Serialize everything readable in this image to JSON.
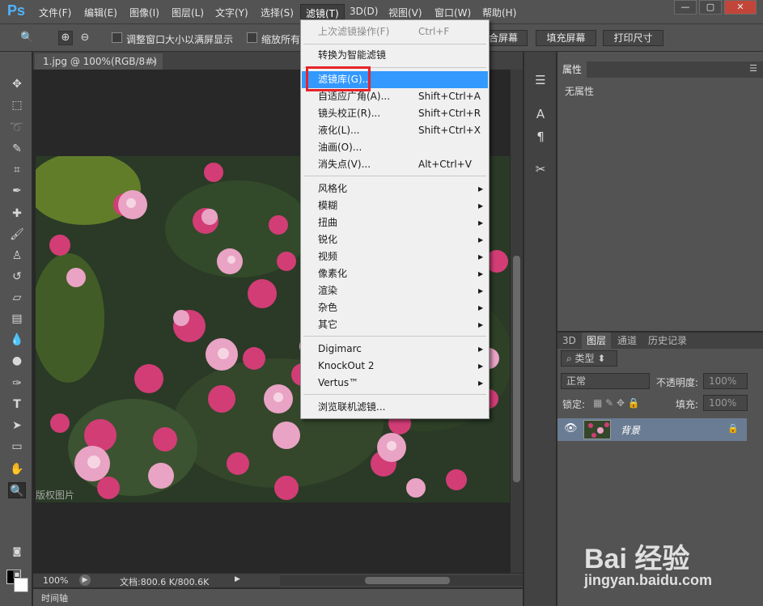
{
  "app": {
    "logo": "Ps"
  },
  "menubar": {
    "items": [
      "文件(F)",
      "编辑(E)",
      "图像(I)",
      "图层(L)",
      "文字(Y)",
      "选择(S)",
      "滤镜(T)",
      "3D(D)",
      "视图(V)",
      "窗口(W)",
      "帮助(H)"
    ],
    "active_index": 6
  },
  "window_controls": {
    "minimize": "—",
    "restore": "▢",
    "close": "✕"
  },
  "options_bar": {
    "checkbox1_label": "调整窗口大小以满屏显示",
    "checkbox2_label": "缩放所有",
    "btn_fit_screen": "合屏幕",
    "btn_fill_screen": "填充屏幕",
    "btn_print_size": "打印尺寸"
  },
  "document": {
    "tab_title": "1.jpg @ 100%(RGB/8#)",
    "tab_close": "×",
    "photo_watermark": "版权图片",
    "zoom": "100%",
    "doc_size": "文档:800.6 K/800.6K",
    "timeline_label": "时间轴"
  },
  "filter_menu": {
    "items": [
      {
        "label": "上次滤镜操作(F)",
        "shortcut": "Ctrl+F",
        "state": "disabled"
      },
      {
        "label": "转换为智能滤镜",
        "shortcut": "",
        "state": "normal"
      },
      {
        "label": "滤镜库(G)...",
        "shortcut": "",
        "state": "highlighted"
      },
      {
        "label": "自适应广角(A)...",
        "shortcut": "Shift+Ctrl+A",
        "state": "normal"
      },
      {
        "label": "镜头校正(R)...",
        "shortcut": "Shift+Ctrl+R",
        "state": "normal"
      },
      {
        "label": "液化(L)...",
        "shortcut": "Shift+Ctrl+X",
        "state": "normal"
      },
      {
        "label": "油画(O)...",
        "shortcut": "",
        "state": "normal"
      },
      {
        "label": "消失点(V)...",
        "shortcut": "Alt+Ctrl+V",
        "state": "normal"
      },
      {
        "label": "风格化",
        "submenu": true
      },
      {
        "label": "模糊",
        "submenu": true
      },
      {
        "label": "扭曲",
        "submenu": true
      },
      {
        "label": "锐化",
        "submenu": true
      },
      {
        "label": "视频",
        "submenu": true
      },
      {
        "label": "像素化",
        "submenu": true
      },
      {
        "label": "渲染",
        "submenu": true
      },
      {
        "label": "杂色",
        "submenu": true
      },
      {
        "label": "其它",
        "submenu": true
      },
      {
        "label": "Digimarc",
        "submenu": true
      },
      {
        "label": "KnockOut 2",
        "submenu": true
      },
      {
        "label": "Vertus™",
        "submenu": true
      },
      {
        "label": "浏览联机滤镜...",
        "shortcut": "",
        "state": "normal"
      }
    ],
    "highlight_color": "#3399ff",
    "callout_color": "#e8232a"
  },
  "properties_panel": {
    "tab": "属性",
    "content": "无属性"
  },
  "layers_panel": {
    "tabs": [
      "3D",
      "图层",
      "通道",
      "历史记录"
    ],
    "active_tab": 1,
    "filter_kind": "类型",
    "blend_mode": "正常",
    "opacity_label": "不透明度:",
    "opacity_value": "100%",
    "lock_label": "锁定:",
    "fill_label": "填充:",
    "fill_value": "100%",
    "layer_name": "背景"
  },
  "watermark": {
    "brand": "Bai 经验",
    "url": "jingyan.baidu.com"
  }
}
